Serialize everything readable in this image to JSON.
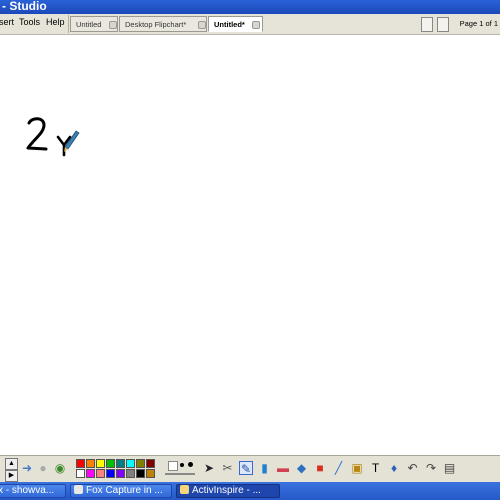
{
  "window": {
    "title": "- Studio"
  },
  "menu": {
    "items": [
      "sert",
      "Tools",
      "Help"
    ]
  },
  "tabs": [
    {
      "label": "Untitled",
      "active": false
    },
    {
      "label": "Desktop Flipchart*",
      "active": false
    },
    {
      "label": "Untitled*",
      "active": true
    }
  ],
  "page_indicator": "Page 1 of 1",
  "canvas": {
    "annotation": "2y"
  },
  "toolbox": {
    "colors": [
      "#ff0000",
      "#ff8000",
      "#ffff00",
      "#00c000",
      "#008080",
      "#00ffff",
      "#808000",
      "#800000",
      "#ffffff",
      "#ff00ff",
      "#ff8080",
      "#0000ff",
      "#8000ff",
      "#808080",
      "#000000",
      "#c08000"
    ],
    "tools": [
      "pointer-icon",
      "marquee-icon",
      "pen-icon",
      "highlighter-icon",
      "eraser-icon",
      "fill-icon",
      "shape-icon",
      "connector-icon",
      "camera-icon",
      "text-icon",
      "clear-icon",
      "undo-icon",
      "redo-icon",
      "page-icon"
    ]
  },
  "taskbar": {
    "items": [
      {
        "label": "x - showva...",
        "active": false
      },
      {
        "label": "Fox Capture in ...",
        "active": false
      },
      {
        "label": "ActivInspire - ...",
        "active": true
      }
    ]
  }
}
